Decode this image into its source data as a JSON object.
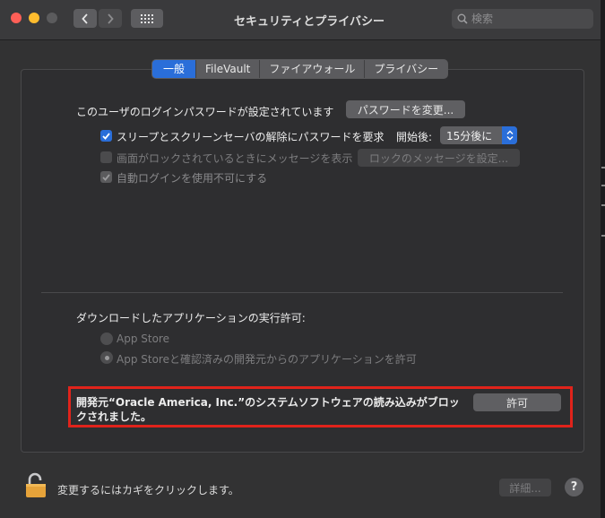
{
  "window": {
    "title": "セキュリティとプライバシー"
  },
  "search": {
    "placeholder": "検索"
  },
  "tabs": [
    {
      "label": "一般",
      "active": true
    },
    {
      "label": "FileVault",
      "active": false
    },
    {
      "label": "ファイアウォール",
      "active": false
    },
    {
      "label": "プライバシー",
      "active": false
    }
  ],
  "general": {
    "login_password_text": "このユーザのログインパスワードが設定されています",
    "change_password_button": "パスワードを変更...",
    "require_password_label": "スリープとスクリーンセーバの解除にパスワードを要求",
    "after_label": "開始後:",
    "after_value": "15分後に",
    "lock_message_label": "画面がロックされているときにメッセージを表示",
    "set_lock_message_button": "ロックのメッセージを設定...",
    "disable_autologin_label": "自動ログインを使用不可にする"
  },
  "downloads": {
    "heading": "ダウンロードしたアプリケーションの実行許可:",
    "option_app_store": "App Store",
    "option_identified": "App Storeと確認済みの開発元からのアプリケーションを許可",
    "blocked_message": "開発元“Oracle America, Inc.”のシステムソフトウェアの読み込みがブロックされました。",
    "allow_button": "許可"
  },
  "footer": {
    "lock_message": "変更するにはカギをクリックします。",
    "advanced_button": "詳細...",
    "help_label": "?"
  },
  "colors": {
    "accent": "#2a6ed9",
    "highlight": "#e0231b"
  }
}
